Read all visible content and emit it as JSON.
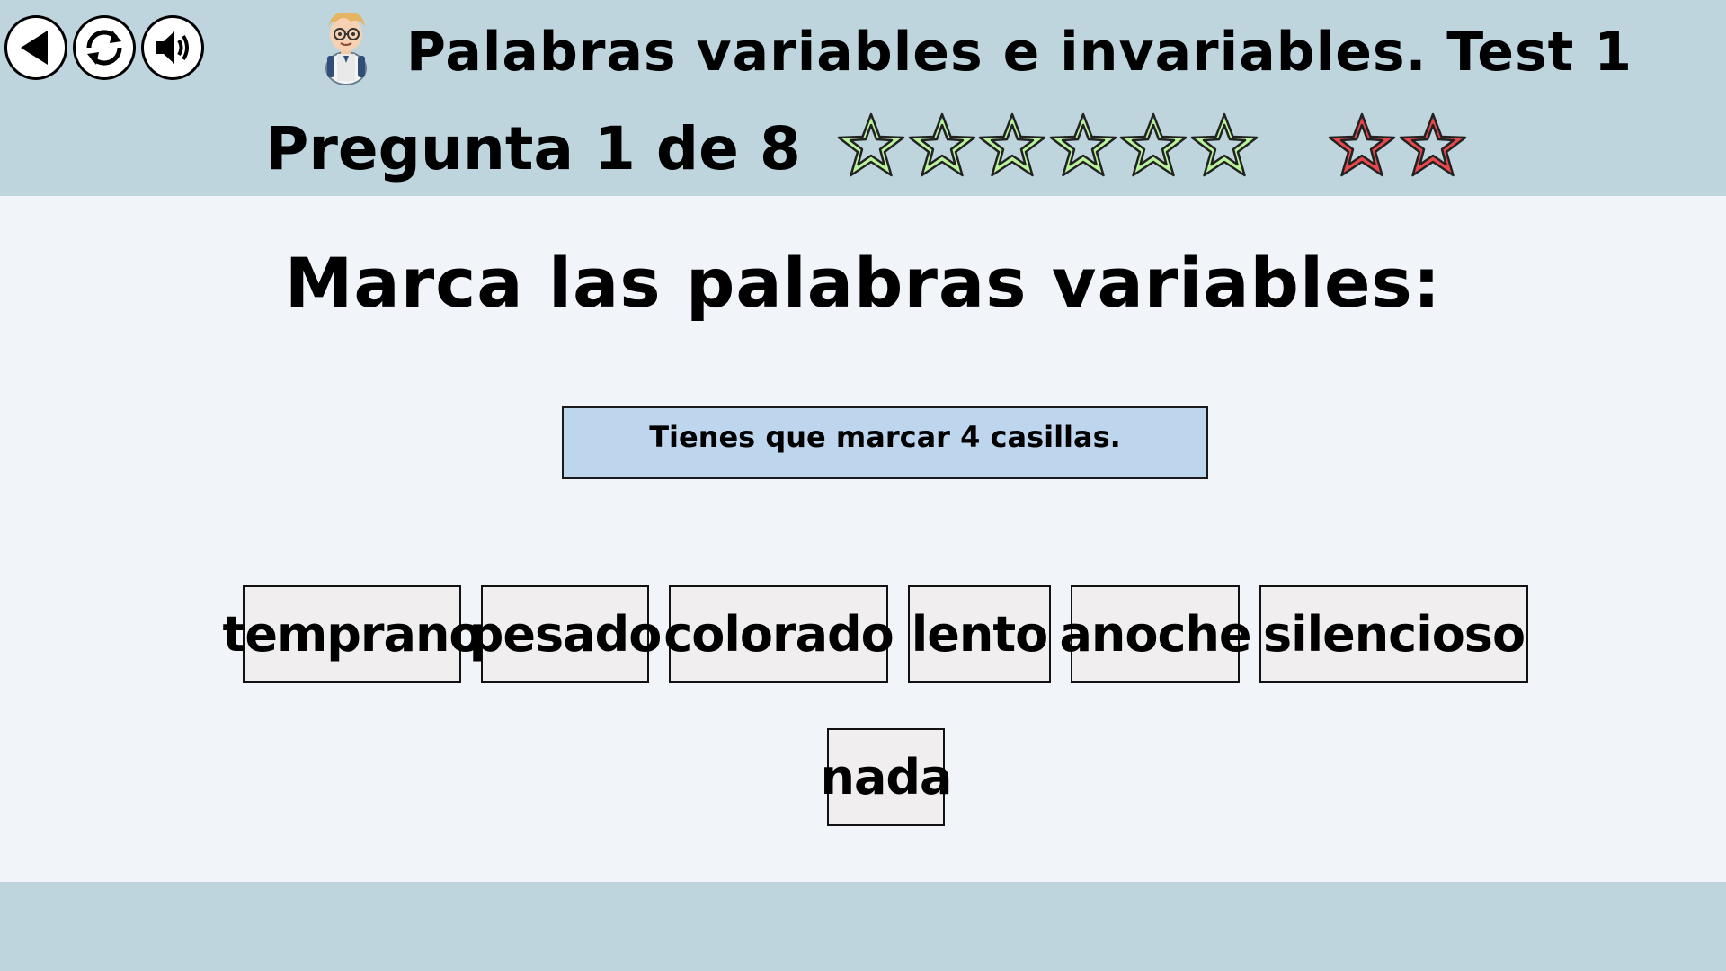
{
  "header": {
    "title": "Palabras variables e invariables. Test 1",
    "question_counter": "Pregunta 1 de 8",
    "buttons": [
      {
        "name": "back-button",
        "icon": "back-arrow-icon"
      },
      {
        "name": "restart-button",
        "icon": "refresh-icon"
      },
      {
        "name": "sound-button",
        "icon": "speaker-icon"
      }
    ],
    "avatar_icon": "student-character-icon"
  },
  "progress": {
    "stars_green": 6,
    "stars_red": 2,
    "colors": {
      "green": "#b9f39b",
      "red": "#e8474c"
    }
  },
  "main": {
    "instruction": "Marca las palabras variables:",
    "hint": "Tienes que marcar 4 casillas.",
    "options": [
      "temprano",
      "pesado",
      "colorado",
      "lento",
      "anoche",
      "silencioso",
      "nada"
    ]
  },
  "colors": {
    "header_bg": "#bfd5de",
    "body_bg": "#f1f5f9",
    "hint_bg": "#bed5ee",
    "option_bg": "#f0eeee"
  }
}
